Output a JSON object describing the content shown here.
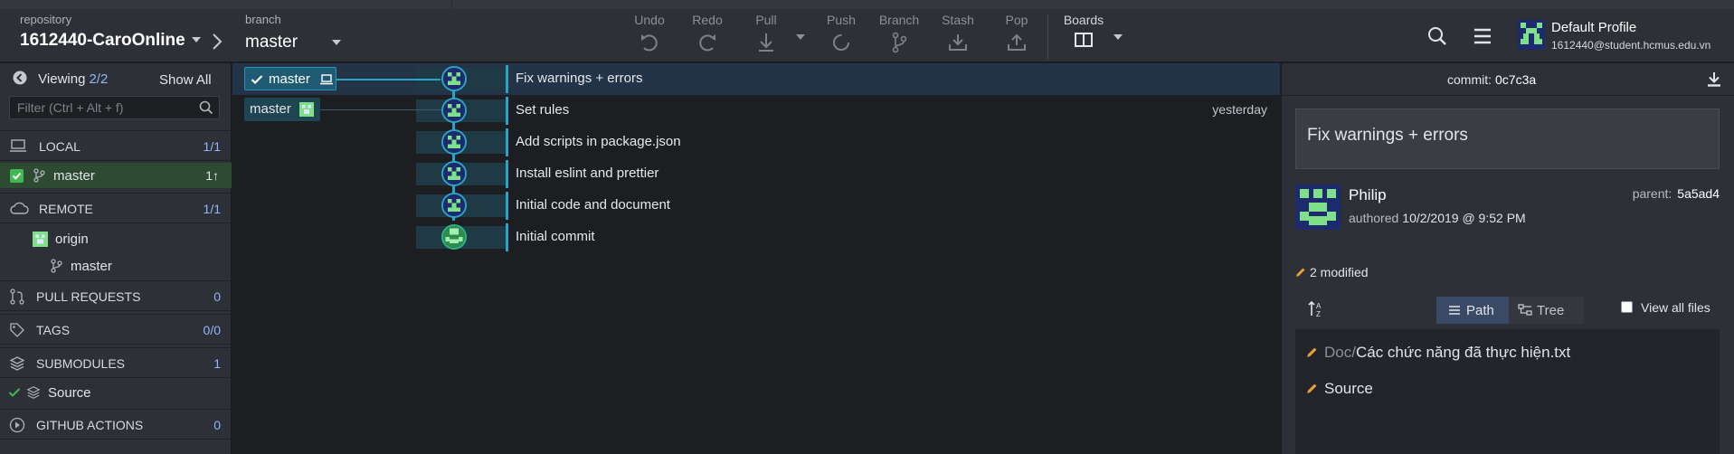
{
  "toolbar": {
    "repository_label": "repository",
    "repository_name": "1612440-CaroOnline",
    "branch_label": "branch",
    "branch_name": "master",
    "actions": [
      {
        "label": "Undo",
        "icon": "undo-icon"
      },
      {
        "label": "Redo",
        "icon": "redo-icon"
      },
      {
        "label": "Pull",
        "icon": "pull-icon"
      },
      {
        "label": "Push",
        "icon": "push-icon"
      },
      {
        "label": "Branch",
        "icon": "branch-icon"
      },
      {
        "label": "Stash",
        "icon": "stash-icon"
      },
      {
        "label": "Pop",
        "icon": "pop-icon"
      }
    ],
    "boards_label": "Boards",
    "profile_name": "Default Profile",
    "profile_email": "1612440@student.hcmus.edu.vn"
  },
  "sidebar": {
    "viewing_label": "Viewing",
    "viewing_count": "2/2",
    "show_all": "Show All",
    "filter_placeholder": "Filter (Ctrl + Alt + f)",
    "local": {
      "label": "LOCAL",
      "count": "1/1"
    },
    "local_branch": {
      "name": "master",
      "status": "1↑"
    },
    "remote": {
      "label": "REMOTE",
      "count": "1/1"
    },
    "remote_origin": "origin",
    "remote_branch": "master",
    "pull_requests": {
      "label": "PULL REQUESTS",
      "count": "0"
    },
    "tags": {
      "label": "TAGS",
      "count": "0/0"
    },
    "submodules": {
      "label": "SUBMODULES",
      "count": "1"
    },
    "submodule_item": "Source",
    "github_actions": {
      "label": "GITHUB ACTIONS",
      "count": "0"
    }
  },
  "graph": {
    "branch_chips": [
      "master",
      "master"
    ],
    "commits": [
      {
        "message": "Fix warnings + errors",
        "date": ""
      },
      {
        "message": "Set rules",
        "date": "yesterday"
      },
      {
        "message": "Add scripts in package.json",
        "date": ""
      },
      {
        "message": "Install eslint and prettier",
        "date": ""
      },
      {
        "message": "Initial code and document",
        "date": ""
      },
      {
        "message": "Initial commit",
        "date": ""
      }
    ]
  },
  "detail": {
    "commit_label": "commit:",
    "commit_sha": "0c7c3a",
    "summary": "Fix warnings + errors",
    "author": "Philip",
    "authored_label": "authored",
    "authored_date": "10/2/2019 @ 9:52 PM",
    "parent_label": "parent:",
    "parent_sha": "5a5ad4",
    "modified": "2 modified",
    "path_label": "Path",
    "tree_label": "Tree",
    "view_all_files": "View all files",
    "files": [
      {
        "dir": "Doc/",
        "name": "Các chức năng đã thực hiện.txt"
      },
      {
        "dir": "",
        "name": "Source"
      }
    ]
  },
  "colors": {
    "accent": "#2aa3c7",
    "selected_row": "#233348",
    "count_blue": "#8fb6ff",
    "avatar_green": "#7fe08a",
    "avatar_navy": "#1e2a6e"
  }
}
